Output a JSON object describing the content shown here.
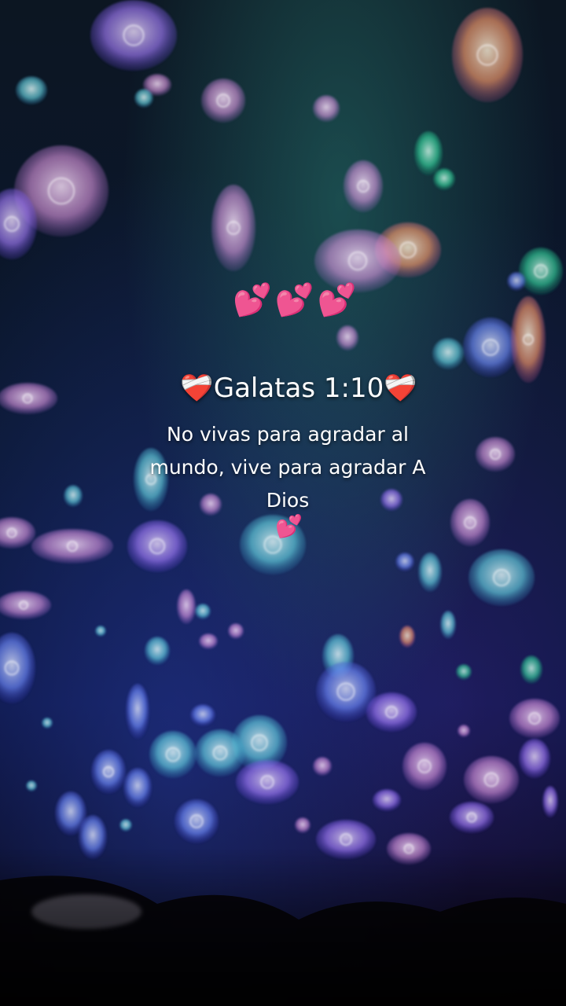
{
  "overlay": {
    "hearts_top": "💕💕💕",
    "verse_reference": "❤️‍🩹Galatas 1:10❤️‍🩹",
    "verse_text": "No vivas para agradar al mundo, vive para agradar A Dios",
    "heart_small": "💕"
  },
  "colors": {
    "jelly_pink": "#f2a6e6",
    "jelly_violet": "#b98cff",
    "jelly_cyan": "#6fe8e6",
    "jelly_green": "#3fe3a8",
    "jelly_orange": "#ff9a6b",
    "jelly_blue": "#6f8bff"
  }
}
